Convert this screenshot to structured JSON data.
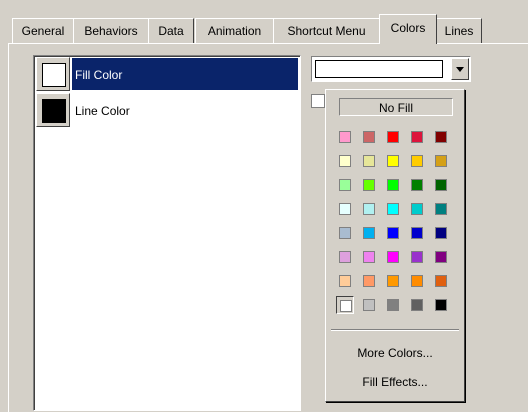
{
  "tabs": [
    {
      "label": "General",
      "active": false
    },
    {
      "label": "Behaviors",
      "active": false
    },
    {
      "label": "Data",
      "active": false
    },
    {
      "label": "Animation",
      "active": false
    },
    {
      "label": "Shortcut Menu",
      "active": false
    },
    {
      "label": "Colors",
      "active": true
    },
    {
      "label": "Lines",
      "active": false
    }
  ],
  "color_list": [
    {
      "label": "Fill Color",
      "swatch": "#ffffff",
      "selected": true
    },
    {
      "label": "Line Color",
      "swatch": "#000000",
      "selected": false
    }
  ],
  "fill_combo": {
    "value_color": "#ffffff"
  },
  "popup": {
    "no_fill_label": "No Fill",
    "palette": [
      [
        "#ff99cc",
        "#cc6666",
        "#ff0000",
        "#dc143c",
        "#800000"
      ],
      [
        "#ffffcc",
        "#e6e699",
        "#ffff00",
        "#ffcc00",
        "#d4a017"
      ],
      [
        "#99ff99",
        "#66ff00",
        "#00ff00",
        "#008000",
        "#006400"
      ],
      [
        "#e6ffff",
        "#b0f0f0",
        "#00ffff",
        "#00cccc",
        "#008080"
      ],
      [
        "#a9bcd0",
        "#00b0f0",
        "#0000ff",
        "#0000cc",
        "#000080"
      ],
      [
        "#dda0dd",
        "#ee82ee",
        "#ff00ff",
        "#9932cc",
        "#800080"
      ],
      [
        "#ffcc99",
        "#ff9966",
        "#ff9900",
        "#ff8c00",
        "#e06010"
      ],
      [
        "#ffffff",
        "#c0c0c0",
        "#808080",
        "#606060",
        "#000000"
      ]
    ],
    "selected_swatch": "#ffffff",
    "more_colors_label": "More Colors...",
    "fill_effects_label": "Fill Effects..."
  }
}
